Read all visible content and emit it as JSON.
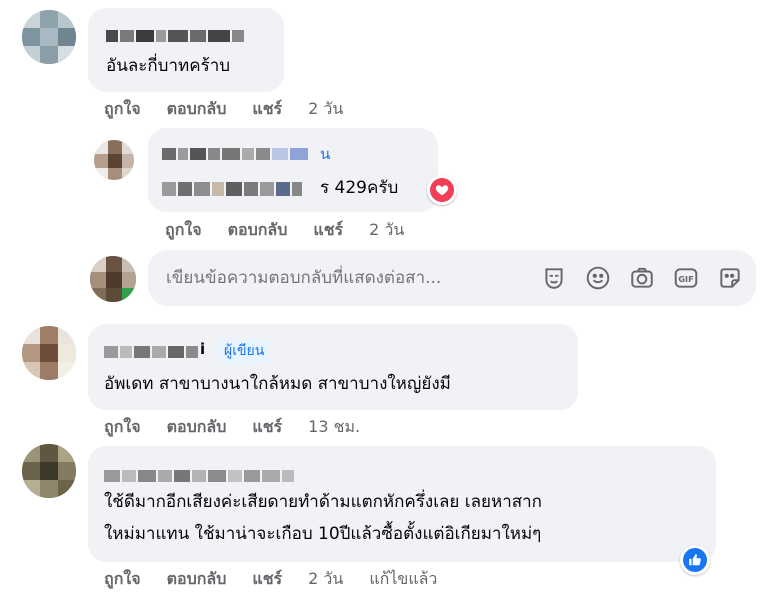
{
  "comments": [
    {
      "text_lines": [
        "อันละกี่บาทคร้าบ"
      ],
      "actions": {
        "like": "ถูกใจ",
        "reply": "ตอบกลับ",
        "share": "แชร์",
        "time": "2 วัน"
      }
    },
    {
      "name_suffix": "น",
      "text_suffix": "ร 429ครับ",
      "reaction": "heart-reaction",
      "actions": {
        "like": "ถูกใจ",
        "reply": "ตอบกลับ",
        "share": "แชร์",
        "time": "2 วัน"
      }
    },
    {
      "name_suffix": "i",
      "badge": "ผู้เขียน",
      "text_lines": [
        "อัพเดท สาขาบางนาใกล้หมด สาขาบางใหญ่ยังมี"
      ],
      "actions": {
        "like": "ถูกใจ",
        "reply": "ตอบกลับ",
        "share": "แชร์",
        "time": "13 ชม."
      }
    },
    {
      "text_lines": [
        "ใช้ดีมากอีกเสียงค่ะเสียดายทำด้ามแตกหักครึ่งเลย เลยหาสาก",
        "ใหม่มาแทน ใช้มาน่าจะเกือบ 10ปีแล้วซื้อตั้งแต่อิเกียมาใหม่ๆ"
      ],
      "reaction": "like-reaction",
      "actions": {
        "like": "ถูกใจ",
        "reply": "ตอบกลับ",
        "share": "แชร์",
        "time": "2 วัน",
        "edited": "แก้ไขแล้ว"
      }
    }
  ],
  "reply_box": {
    "placeholder": "เขียนข้อความตอบกลับที่แสดงต่อสา...",
    "tools": [
      "sticker-face-icon",
      "emoji-icon",
      "camera-icon",
      "gif-icon",
      "sticker-icon"
    ]
  },
  "colors": {
    "bubble": "#f0f2f5",
    "secondary_text": "#65676b",
    "author_badge_bg": "#e7f3ff",
    "author_badge_text": "#1b74e4",
    "heart": "#f33e58",
    "like": "#1877f2"
  }
}
